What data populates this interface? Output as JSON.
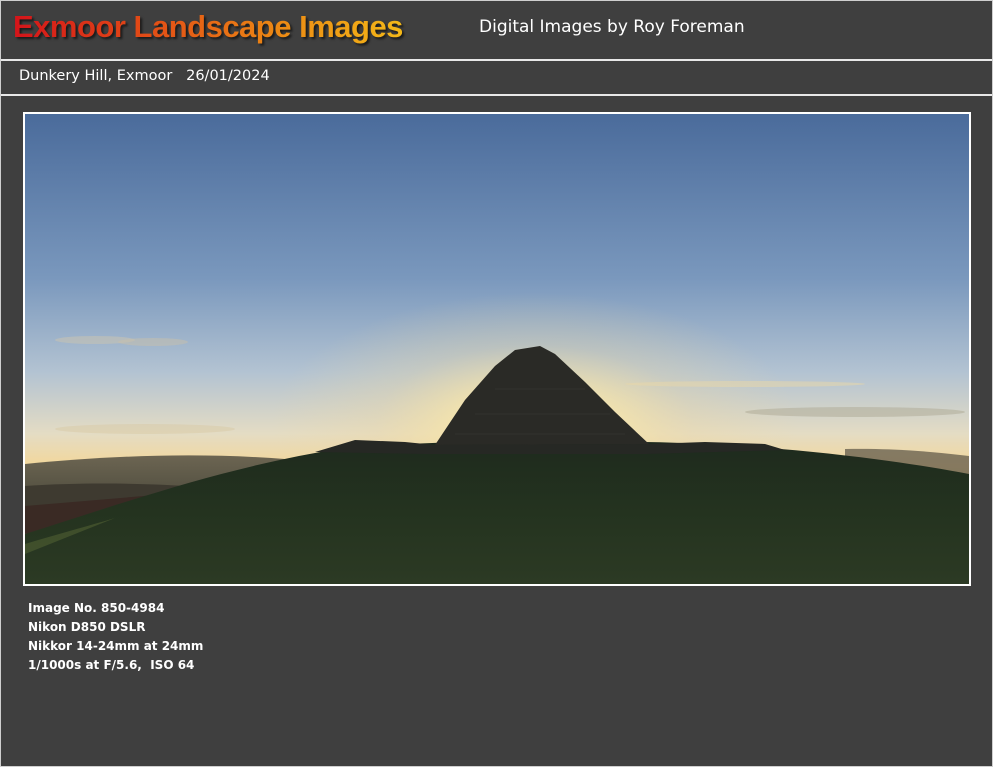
{
  "header": {
    "title": "Exmoor Landscape Images",
    "subtitle": "Digital Images by Roy Foreman"
  },
  "caption": {
    "location": "Dunkery Hill, Exmoor",
    "date": "26/01/2024"
  },
  "photo": {
    "subject": "cairn-silhouette-sunset-photo"
  },
  "exif": {
    "image_no": "Image No. 850-4984",
    "camera": "Nikon D850 DSLR",
    "lens": "Nikkor 14-24mm at 24mm",
    "exposure": "1/1000s at F/5.6,  ISO 64"
  },
  "colors": {
    "background": "#3f3f3f",
    "title_red": "#d4141a",
    "title_orange": "#ec8c14",
    "text": "#ffffff"
  }
}
